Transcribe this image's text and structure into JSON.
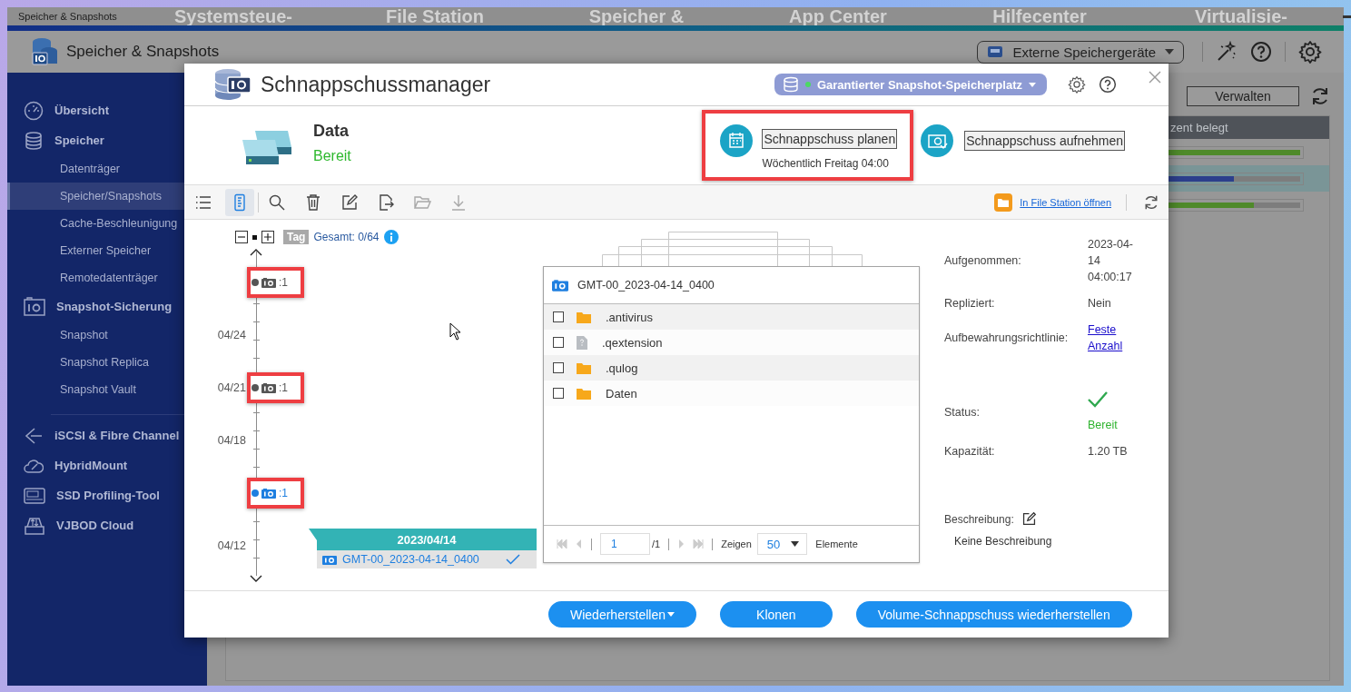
{
  "desktop": {
    "icons": [
      {
        "label": "Systemsteue-"
      },
      {
        "label": "File Station"
      },
      {
        "label": "Speicher &"
      },
      {
        "label": "App Center"
      },
      {
        "label": "Hilfecenter"
      },
      {
        "label": "Virtualisie-"
      }
    ]
  },
  "app_window": {
    "title": "Speicher & Snapshots",
    "app_name": "Speicher & Snapshots",
    "external_devices": "Externe Speichergeräte",
    "sidebar": {
      "groups": [
        {
          "items": [
            {
              "label": "Übersicht",
              "selected": false
            },
            {
              "label": "Speicher",
              "selected": false,
              "children": [
                {
                  "label": "Datenträger",
                  "selected": false
                },
                {
                  "label": "Speicher/Snapshots",
                  "selected": true
                },
                {
                  "label": "Cache-Beschleunigung",
                  "selected": false
                },
                {
                  "label": "Externer Speicher",
                  "selected": false
                },
                {
                  "label": "Remotedatenträger",
                  "selected": false
                }
              ]
            },
            {
              "label": "Snapshot-Sicherung",
              "selected": false,
              "children": [
                {
                  "label": "Snapshot",
                  "selected": false
                },
                {
                  "label": "Snapshot Replica",
                  "selected": false
                },
                {
                  "label": "Snapshot Vault",
                  "selected": false
                }
              ]
            }
          ]
        },
        {
          "items": [
            {
              "label": "iSCSI & Fibre Channel",
              "selected": false
            },
            {
              "label": "HybridMount",
              "selected": false
            },
            {
              "label": "SSD Profiling-Tool",
              "selected": false
            },
            {
              "label": "VJBOD Cloud",
              "selected": false
            }
          ]
        }
      ]
    },
    "manage_button": "Verwalten",
    "table": {
      "column_header": "zent belegt",
      "rows": [
        {
          "selected": false,
          "level": 1
        },
        {
          "selected": true,
          "level": 0.5
        },
        {
          "selected": false,
          "level": 0.65
        }
      ]
    }
  },
  "modal": {
    "title": "Schnappschussmanager",
    "space_button": {
      "label": "Garantierter Snapshot-Speicherplatz",
      "on": true
    },
    "volume": {
      "name": "Data",
      "status": "Bereit"
    },
    "schedule": {
      "button": "Schnappschuss planen",
      "summary": "Wöchentlich Freitag 04:00",
      "highlighted": true
    },
    "take_snapshot": {
      "button": "Schnappschuss aufnehmen"
    },
    "toolbar": {
      "tools": [
        {
          "selected": false,
          "disabled": false
        },
        {
          "selected": true,
          "disabled": false
        },
        {
          "selected": false,
          "disabled": false
        },
        {
          "selected": false,
          "disabled": false
        },
        {
          "selected": false,
          "disabled": false
        },
        {
          "selected": false,
          "disabled": false
        },
        {
          "selected": false,
          "disabled": true
        },
        {
          "selected": false,
          "disabled": true
        }
      ],
      "file_station_link": "In File Station öffnen"
    },
    "timeline": {
      "unit": "Tag",
      "total": "Gesamt: 0/64",
      "rows": [
        {
          "marker": {
            "count": ":1",
            "selected": false,
            "highlighted": true
          }
        },
        {
          "label": "04/24"
        },
        {
          "label": "04/21",
          "marker": {
            "count": ":1",
            "selected": false,
            "highlighted": true
          }
        },
        {
          "label": "04/18"
        },
        {
          "marker": {
            "count": ":1",
            "selected": true,
            "highlighted": true
          }
        },
        {
          "label": "04/12"
        }
      ],
      "date_group": {
        "date": "2023/04/14",
        "snapshots": [
          {
            "name": "GMT-00_2023-04-14_0400",
            "selected": true
          }
        ]
      }
    },
    "file_browser": {
      "snapshot": "GMT-00_2023-04-14_0400",
      "items": [
        {
          "name": ".antivirus",
          "kind": "folder",
          "checked": false
        },
        {
          "name": ".qextension",
          "kind": "file",
          "checked": false
        },
        {
          "name": ".qulog",
          "kind": "folder",
          "checked": false
        },
        {
          "name": "Daten",
          "kind": "folder",
          "checked": false
        }
      ],
      "pagination": {
        "page": "1",
        "page_count": "/1",
        "show_label": "Zeigen",
        "page_size": "50",
        "items_label": "Elemente"
      }
    },
    "details": [
      {
        "label": "Aufgenommen:",
        "value": "2023-04-14 04:00:17",
        "kind": "text"
      },
      {
        "label": "Repliziert:",
        "value": "Nein",
        "kind": "text"
      },
      {
        "label": "Aufbewahrungsrichtlinie:",
        "value": "Feste Anzahl",
        "kind": "link"
      },
      {
        "label": "Status:",
        "value": "Bereit",
        "kind": "status"
      },
      {
        "label": "Kapazität:",
        "value": "1.20 TB",
        "kind": "text"
      }
    ],
    "description": {
      "label": "Beschreibung:",
      "value": "Keine Beschreibung"
    },
    "actions": [
      {
        "label": "Wiederherstellen",
        "kind": "menu"
      },
      {
        "label": "Klonen",
        "kind": "plain"
      },
      {
        "label": "Volume-Schnappschuss wiederherstellen",
        "kind": "plain"
      }
    ]
  }
}
